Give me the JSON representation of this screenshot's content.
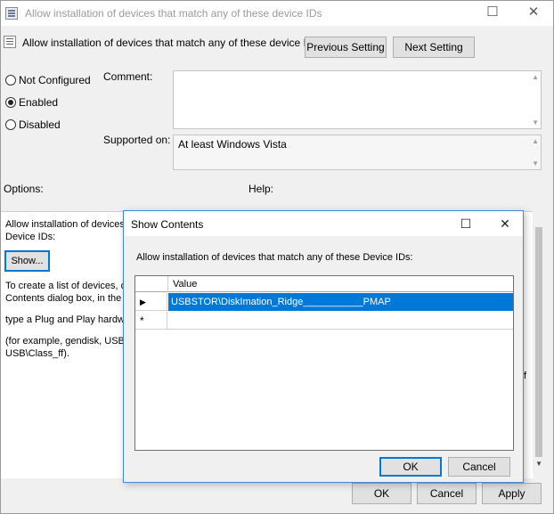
{
  "window": {
    "title": "Allow installation of devices that match any of these device IDs",
    "heading": "Allow installation of devices that match any of these device IDs",
    "previous_setting": "Previous Setting",
    "next_setting": "Next Setting"
  },
  "state": {
    "options": [
      "Not Configured",
      "Enabled",
      "Disabled"
    ],
    "selected": "Enabled"
  },
  "comment_label": "Comment:",
  "comment_value": "",
  "supported_on_label": "Supported on:",
  "supported_on_value": "At least Windows Vista",
  "options_label": "Options:",
  "help_label": "Help:",
  "options_pane": {
    "line1": "Allow installation of devices",
    "line2": "Device IDs:",
    "show_button": "Show...",
    "para1_line1": "To create a list of devices, cli",
    "para1_line2": "Contents dialog box, in the V",
    "para2": "type a Plug and Play hardwa",
    "para3_line1": "(for example, gendisk, USB\\C",
    "para3_line2": "USB\\Class_ff)."
  },
  "help_fragment": "f",
  "footer": {
    "ok": "OK",
    "cancel": "Cancel",
    "apply": "Apply"
  },
  "show_contents": {
    "title": "Show Contents",
    "caption": "Allow installation of devices that match any of these Device IDs:",
    "column_header": "Value",
    "rows": [
      {
        "marker": "▶",
        "value": "USBSTOR\\DiskImation_Ridge___________PMAP"
      },
      {
        "marker": "*",
        "value": ""
      }
    ],
    "ok": "OK",
    "cancel": "Cancel"
  }
}
